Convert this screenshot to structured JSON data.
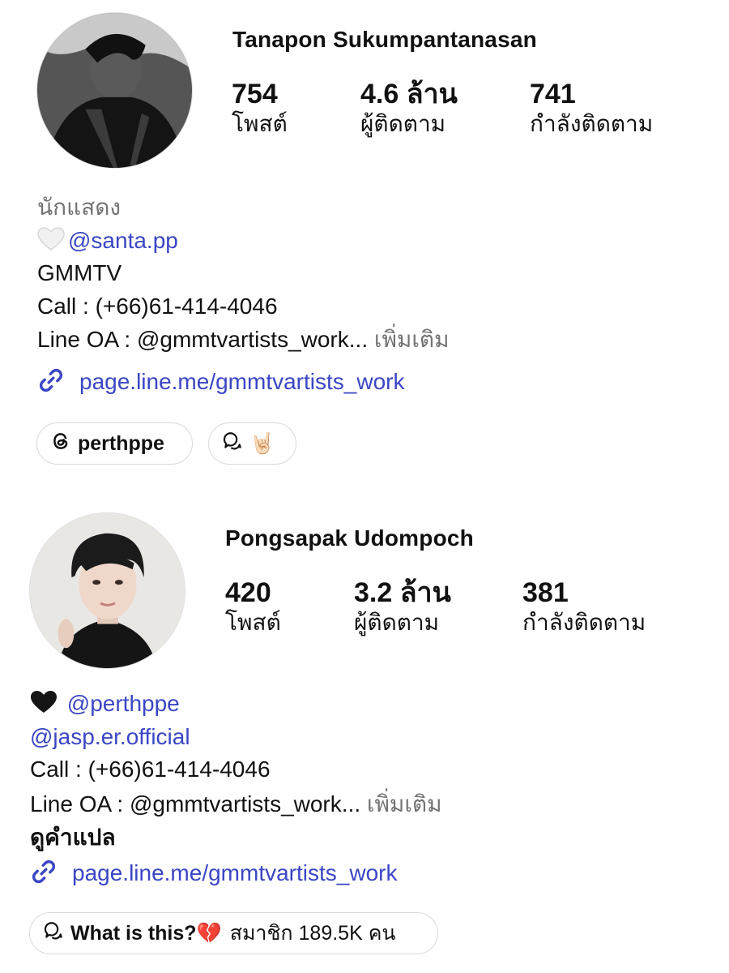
{
  "profiles": [
    {
      "name": "Tanapon Sukumpantanasan",
      "stats": [
        {
          "value": "754",
          "label": "โพสต์"
        },
        {
          "value": "4.6 ล้าน",
          "label": "ผู้ติดตาม"
        },
        {
          "value": "741",
          "label": "กำลังติดตาม"
        }
      ],
      "category": "นักแสดง",
      "mention_line": {
        "emoji": "white-heart",
        "handle": "@santa.pp"
      },
      "bio_text": "GMMTV",
      "call": "Call : (+66)61-414-4046",
      "line_oa": "Line OA : @gmmtvartists_work...",
      "more": "เพิ่มเติม",
      "link": "page.line.me/gmmtvartists_work",
      "chips": [
        {
          "icon": "threads-icon",
          "label": "perthppe"
        },
        {
          "icon": "broadcast-channel-icon",
          "label": "🤘🏻"
        }
      ]
    },
    {
      "name": "Pongsapak Udompoch",
      "stats": [
        {
          "value": "420",
          "label": "โพสต์"
        },
        {
          "value": "3.2 ล้าน",
          "label": "ผู้ติดตาม"
        },
        {
          "value": "381",
          "label": "กำลังติดตาม"
        }
      ],
      "mention_line": {
        "emoji": "black-heart",
        "handle": "@perthppe"
      },
      "handle2": "@jasp.er.official",
      "call": "Call : (+66)61-414-4046",
      "line_oa": "Line OA : @gmmtvartists_work...",
      "more": "เพิ่มเติม",
      "translate": "ดูคำแปล",
      "link": "page.line.me/gmmtvartists_work",
      "chips": [
        {
          "icon": "broadcast-channel-icon",
          "label": "What is this?💔",
          "sub": "สมาชิก 189.5K คน"
        }
      ]
    }
  ],
  "colors": {
    "link_blue": "#3a46c4",
    "muted_gray": "#737373",
    "chip_border": "#d9d9d9"
  }
}
